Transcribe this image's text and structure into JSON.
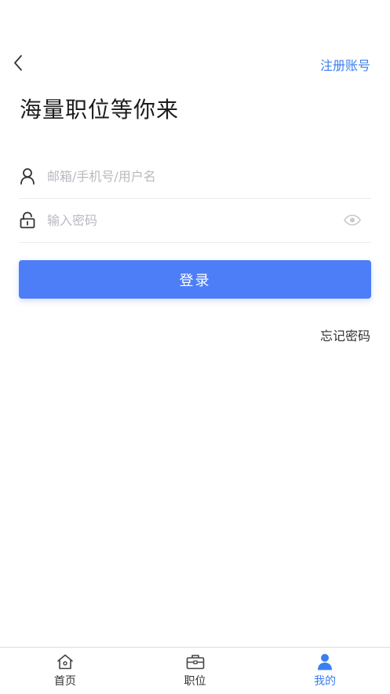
{
  "header": {
    "back_icon": "chevron-left-icon",
    "register_label": "注册账号"
  },
  "title": "海量职位等你来",
  "form": {
    "username": {
      "icon": "user-icon",
      "placeholder": "邮箱/手机号/用户名",
      "value": ""
    },
    "password": {
      "icon": "lock-icon",
      "placeholder": "输入密码",
      "value": "",
      "toggle_icon": "eye-icon"
    },
    "login_label": "登录",
    "forgot_label": "忘记密码"
  },
  "tabbar": {
    "tabs": [
      {
        "label": "首页",
        "icon": "home-icon",
        "active": false
      },
      {
        "label": "职位",
        "icon": "briefcase-icon",
        "active": false
      },
      {
        "label": "我的",
        "icon": "user-filled-icon",
        "active": true
      }
    ]
  },
  "colors": {
    "accent": "#3b7ff0",
    "button": "#4e7ef7",
    "placeholder": "#b9b9c1"
  }
}
